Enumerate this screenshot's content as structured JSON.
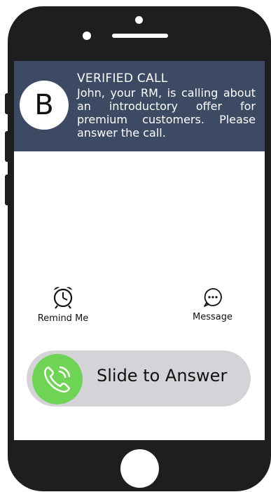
{
  "notification": {
    "brand_initial": "B",
    "title": "VERIFIED CALL",
    "message": "John, your RM, is calling about an introductory offer for premium customers. Please answer the call."
  },
  "actions": {
    "remind": {
      "label": "Remind Me",
      "icon": "alarm-clock-icon"
    },
    "message": {
      "label": "Message",
      "icon": "message-bubble-icon"
    }
  },
  "slider": {
    "label": "Slide to Answer",
    "icon": "phone-icon"
  },
  "colors": {
    "notification_bg": "#3d4a63",
    "answer_green": "#6fd355",
    "slider_track": "#d4d3d7",
    "phone_frame": "#1e1e1e"
  }
}
